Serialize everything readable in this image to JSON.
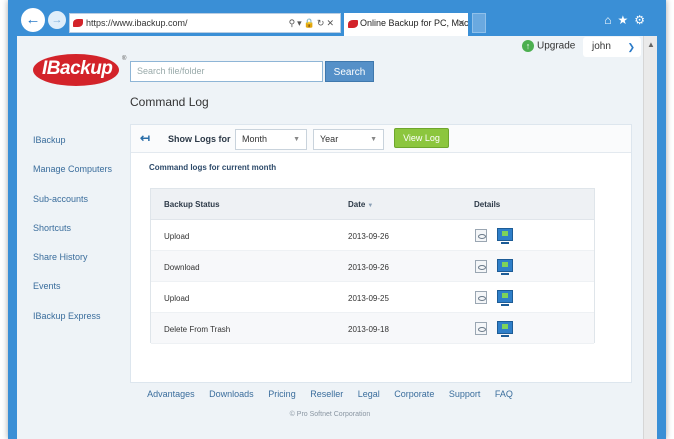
{
  "browser": {
    "url": "https://www.ibackup.com/",
    "tab_title": "Online Backup for PC, Mac ..."
  },
  "header": {
    "upgrade_label": "Upgrade",
    "user_name": "john",
    "search_placeholder": "Search file/folder",
    "search_button": "Search",
    "logo_text": "IBackup"
  },
  "page_title": "Command Log",
  "sidebar": {
    "items": [
      {
        "label": "IBackup"
      },
      {
        "label": "Manage Computers"
      },
      {
        "label": "Sub-accounts"
      },
      {
        "label": "Shortcuts"
      },
      {
        "label": "Share History"
      },
      {
        "label": "Events"
      },
      {
        "label": "IBackup Express"
      }
    ]
  },
  "toolbar": {
    "show_logs_label": "Show Logs for",
    "month_value": "Month",
    "year_value": "Year",
    "view_button": "View Log"
  },
  "subtitle": "Command logs for current month",
  "table": {
    "headers": {
      "status": "Backup Status",
      "date": "Date",
      "details": "Details"
    },
    "rows": [
      {
        "status": "Upload",
        "date": "2013-09-26"
      },
      {
        "status": "Download",
        "date": "2013-09-26"
      },
      {
        "status": "Upload",
        "date": "2013-09-25"
      },
      {
        "status": "Delete From Trash",
        "date": "2013-09-18"
      }
    ]
  },
  "footer": {
    "links": [
      "Advantages",
      "Downloads",
      "Pricing",
      "Reseller",
      "Legal",
      "Corporate",
      "Support",
      "FAQ"
    ],
    "copyright": "© Pro Softnet Corporation"
  },
  "colors": {
    "chrome": "#3a8fd6",
    "brand_red": "#d3232a",
    "view_button": "#8cc63e",
    "link": "#3a6d9c"
  }
}
